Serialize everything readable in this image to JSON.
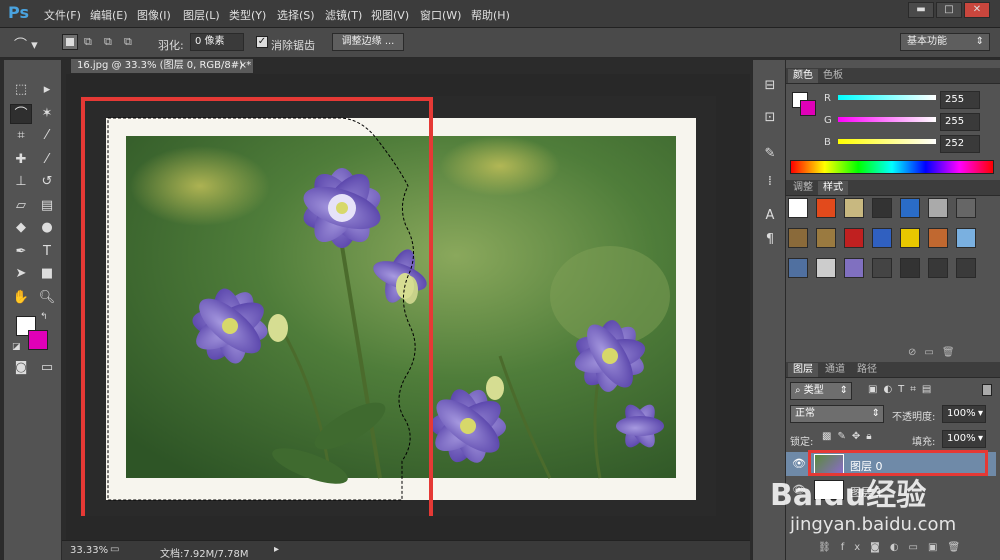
{
  "app": {
    "logo": "Ps",
    "workspace": "基本功能"
  },
  "menu": [
    "文件(F)",
    "编辑(E)",
    "图像(I)",
    "图层(L)",
    "类型(Y)",
    "选择(S)",
    "滤镜(T)",
    "视图(V)",
    "窗口(W)",
    "帮助(H)"
  ],
  "window_buttons": {
    "minimize": "▬",
    "restore": "□",
    "close": "✕"
  },
  "options": {
    "feather_label": "羽化:",
    "feather_value": "0 像素",
    "antialias_label": "消除锯齿",
    "refine_edge": "调整边缘 ..."
  },
  "document": {
    "tab_title": "16.jpg @ 33.3% (图层 0, RGB/8#) *",
    "tab_close": "×"
  },
  "status": {
    "zoom": "33.33%",
    "doc_info": "文档:7.92M/7.78M"
  },
  "color_panel": {
    "tabs": [
      "颜色",
      "色板"
    ],
    "r_label": "R",
    "g_label": "G",
    "b_label": "B",
    "r": "255",
    "g": "255",
    "b": "252"
  },
  "styles_panel": {
    "tabs": [
      "调整",
      "样式"
    ]
  },
  "layers_panel": {
    "tabs": [
      "图层",
      "通道",
      "路径"
    ],
    "filter_kind": "类型",
    "blend_mode": "正常",
    "opacity_label": "不透明度:",
    "opacity": "100%",
    "lock_label": "锁定:",
    "fill_label": "填充:",
    "fill": "100%",
    "layers": [
      "图层 0",
      "图层 1"
    ]
  },
  "watermark": {
    "brand": "Baidu经验",
    "url": "jingyan.baidu.com"
  },
  "colors": {
    "accent_red": "#e53935",
    "foreground": "#ffffff",
    "background_swatch": "#e000b8",
    "selection": "#6f8aa8"
  }
}
